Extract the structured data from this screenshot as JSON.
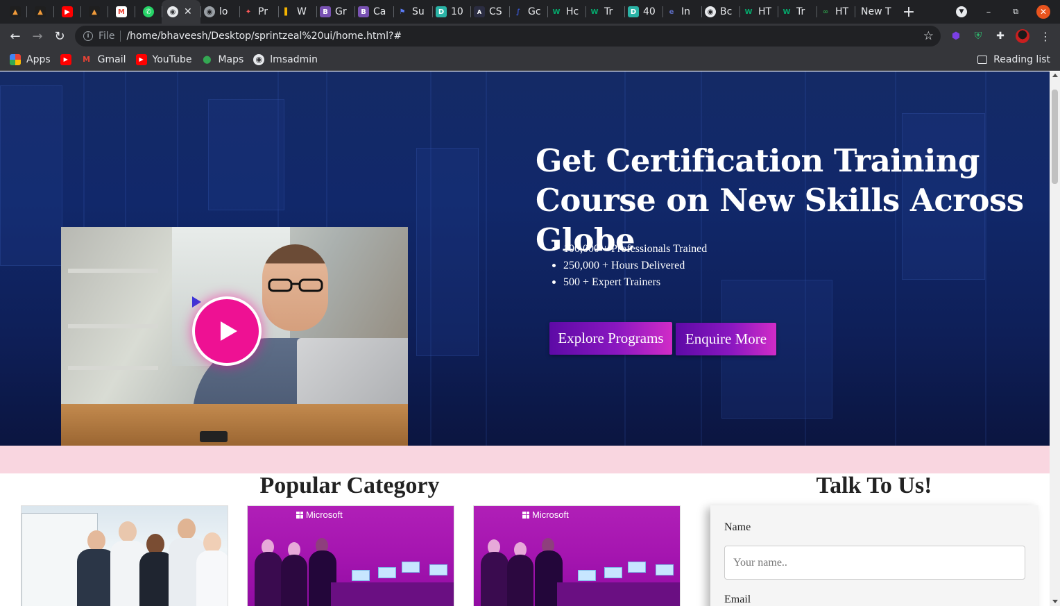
{
  "browser": {
    "tabs": [
      {
        "label": "",
        "icon": "graduation-cap-icon",
        "color": "#1f1f1f"
      },
      {
        "label": "",
        "icon": "graduation-cap-icon",
        "color": "#1f1f1f"
      },
      {
        "label": "",
        "icon": "youtube-icon",
        "color": "#ff0000"
      },
      {
        "label": "",
        "icon": "graduation-cap-icon",
        "color": "#1f1f1f"
      },
      {
        "label": "",
        "icon": "gmail-icon",
        "color": "#ea4335"
      },
      {
        "label": "",
        "icon": "whatsapp-icon",
        "color": "#25d366"
      },
      {
        "label": "",
        "icon": "globe-icon",
        "color": "#e8eaed",
        "active": true
      },
      {
        "label": "lo",
        "icon": "globe-icon",
        "color": "#9aa0a6"
      },
      {
        "label": "Pr",
        "icon": "pen-icon",
        "color": "#7b61ff"
      },
      {
        "label": "W",
        "icon": "bar-icon",
        "color": "#f4b400"
      },
      {
        "label": "Gr",
        "icon": "bootstrap-icon",
        "color": "#7952b3"
      },
      {
        "label": "Ca",
        "icon": "bootstrap-icon",
        "color": "#7952b3"
      },
      {
        "label": "Su",
        "icon": "flag-icon",
        "color": "#5b7cf7"
      },
      {
        "label": "10",
        "icon": "d-icon",
        "color": "#2ab3a6"
      },
      {
        "label": "CS",
        "icon": "angular-icon",
        "color": "#2b2d42"
      },
      {
        "label": "Gc",
        "icon": "script-icon",
        "color": "#3b5bdb"
      },
      {
        "label": "Hc",
        "icon": "w-icon",
        "color": "#04aa6d"
      },
      {
        "label": "Tr",
        "icon": "w-icon",
        "color": "#04aa6d"
      },
      {
        "label": "40",
        "icon": "d-icon",
        "color": "#2ab3a6"
      },
      {
        "label": "In",
        "icon": "el-icon",
        "color": "#5c6bc0"
      },
      {
        "label": "Bc",
        "icon": "globe-icon",
        "color": "#e8eaed"
      },
      {
        "label": "HT",
        "icon": "w-icon",
        "color": "#04aa6d"
      },
      {
        "label": "Tr",
        "icon": "w-icon",
        "color": "#04aa6d"
      },
      {
        "label": "HT",
        "icon": "infinity-icon",
        "color": "#2e7d32"
      },
      {
        "label": "New T",
        "icon": "",
        "color": ""
      }
    ],
    "url_scheme": "File",
    "url": "/home/bhaveesh/Desktop/sprintzeal%20ui/home.html?#",
    "bookmarks": [
      {
        "label": "Apps",
        "icon": "apps-grid-icon"
      },
      {
        "label": "",
        "icon": "youtube-icon"
      },
      {
        "label": "Gmail",
        "icon": "gmail-icon"
      },
      {
        "label": "YouTube",
        "icon": "youtube-icon"
      },
      {
        "label": "Maps",
        "icon": "maps-pin-icon"
      },
      {
        "label": "lmsadmin",
        "icon": "globe-icon"
      }
    ],
    "reading_list": "Reading list"
  },
  "hero": {
    "title": "Get Certification Training Course on New Skills Across Globe",
    "stats": [
      "100,000 + Professionals Trained",
      "250,000 + Hours Delivered",
      "500 + Expert Trainers"
    ],
    "buttons": {
      "explore": "Explore Programs",
      "enquire": "Enquire More"
    }
  },
  "category": {
    "title": "Popular Category",
    "cards": [
      {
        "alt": "team-meeting"
      },
      {
        "alt": "microsoft-event",
        "logo_text": "Microsoft"
      },
      {
        "alt": "microsoft-event",
        "logo_text": "Microsoft"
      }
    ]
  },
  "contact": {
    "title": "Talk To Us!",
    "name_label": "Name",
    "name_placeholder": "Your name..",
    "email_label": "Email"
  },
  "colors": {
    "hero_bg": "#11286a",
    "accent_purple": "#5d0aa6",
    "accent_magenta": "#d12cc7",
    "play_pink": "#ee1193",
    "band_pink": "#f9d6e0"
  }
}
